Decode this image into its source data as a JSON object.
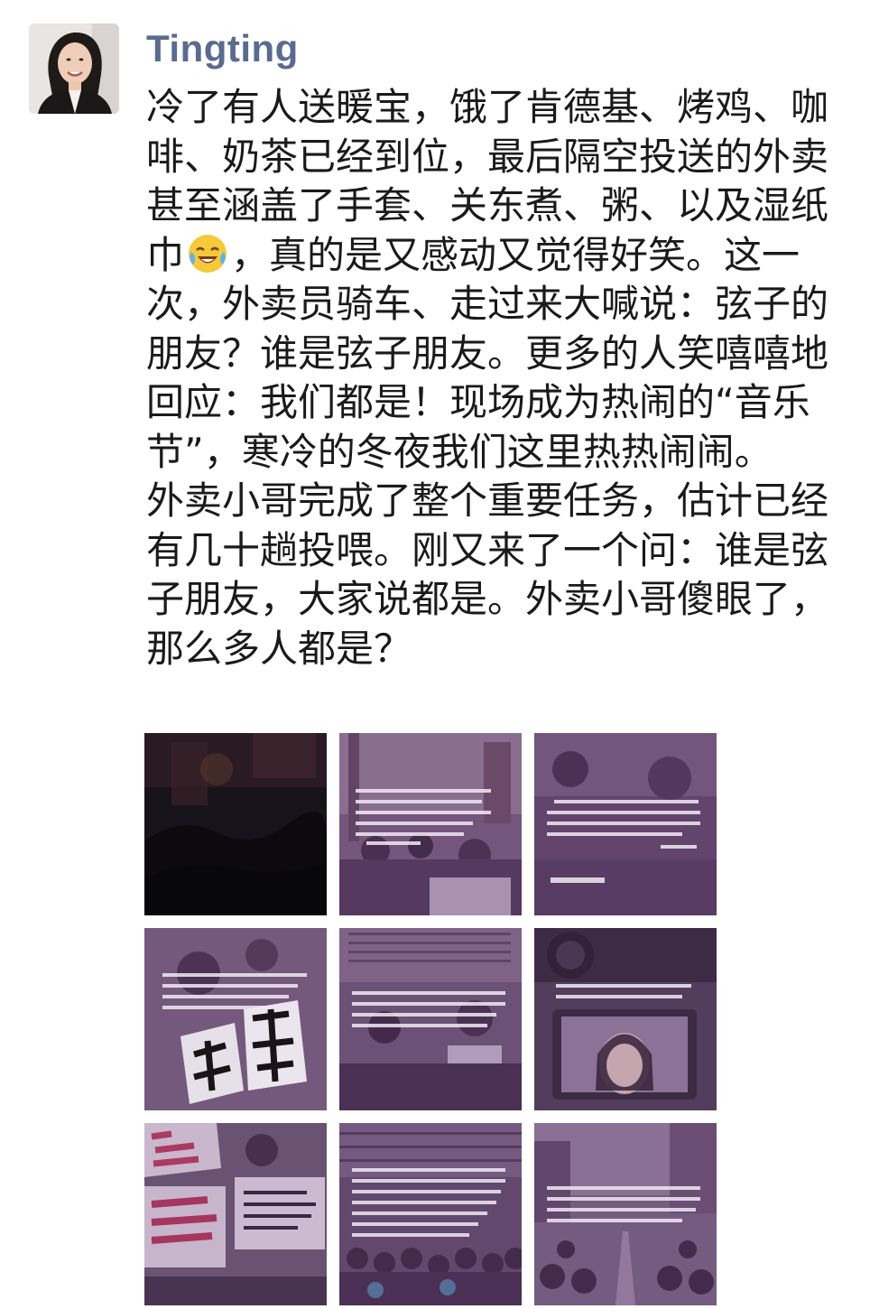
{
  "post": {
    "author": "Tingting",
    "paragraphs": [
      "冷了有人送暖宝，饿了肯德基、烤鸡、咖啡、奶茶已经到位，最后隔空投送的外卖甚至涵盖了手套、关东煮、粥、以及湿纸巾",
      "，真的是又感动又觉得好笑。这一次，外卖员骑车、走过来大喊说：弦子的朋友？谁是弦子朋友。更多的人笑嘻嘻地回应：我们都是！现场成为热闹的“音乐节”，寒冷的冬夜我们这里热热闹闹。",
      "外卖小哥完成了整个重要任务，估计已经有几十趟投喂。刚又来了一个问：谁是弦子朋友，大家说都是。外卖小哥傻眼了，那么多人都是？"
    ],
    "emoji": "laughing-crying-emoji"
  },
  "images": [
    {
      "name": "photo-night-crowd",
      "overlay": false
    },
    {
      "name": "photo-crowd-quote",
      "overlay": true
    },
    {
      "name": "photo-metoo-quote",
      "overlay": true
    },
    {
      "name": "photo-calligraphy-signs",
      "overlay": true
    },
    {
      "name": "photo-building-crowd",
      "overlay": true
    },
    {
      "name": "photo-camera-screen",
      "overlay": true
    },
    {
      "name": "photo-protest-signs",
      "overlay": true
    },
    {
      "name": "photo-seated-crowd",
      "overlay": true
    },
    {
      "name": "photo-street-crowd",
      "overlay": true
    }
  ],
  "colors": {
    "author": "#5a6b8f",
    "text": "#1a1a1a",
    "overlay": "#6a3a78"
  }
}
